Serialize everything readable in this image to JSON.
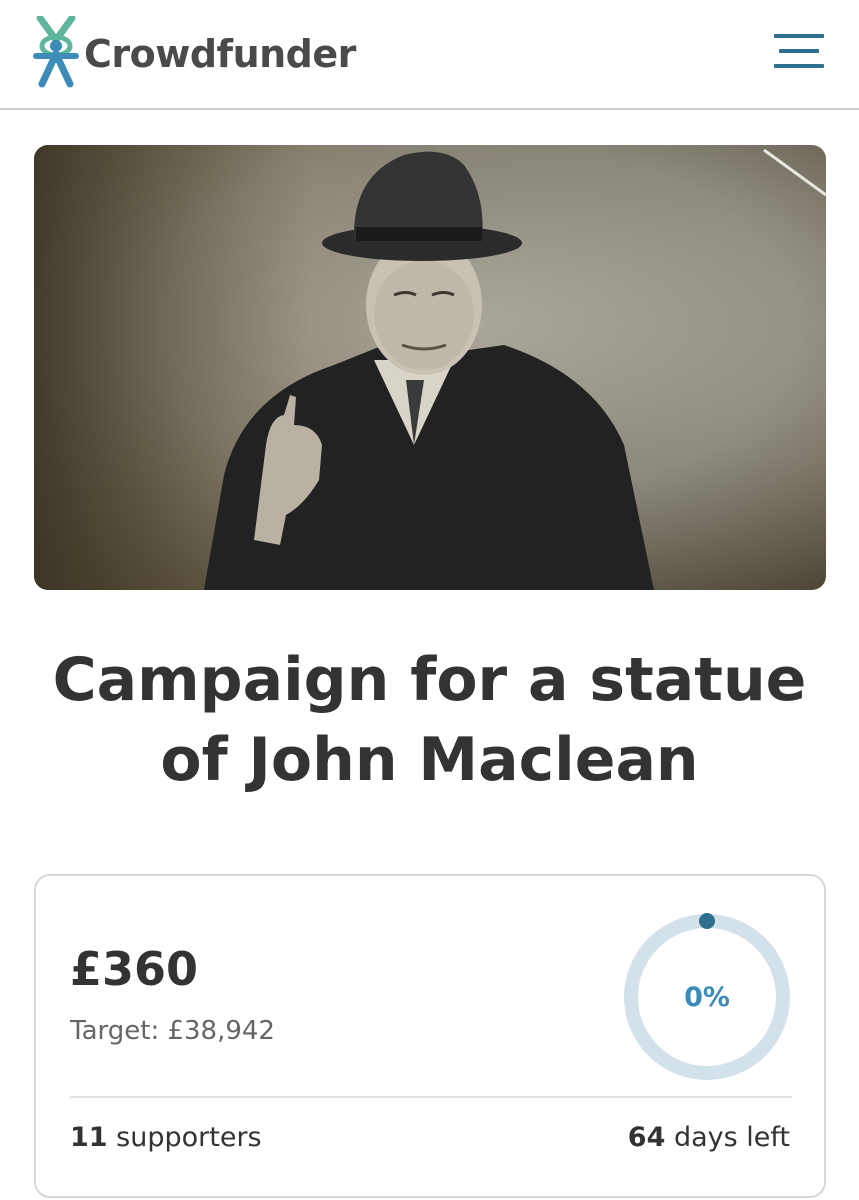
{
  "header": {
    "brand": "Crowdfunder",
    "menu_icon": "hamburger-menu-icon",
    "logo_icon": "crowdfunder-person-icon",
    "colors": {
      "logo_green": "#5fb69c",
      "logo_blue": "#3d8bb6",
      "menu": "#2f6f8f"
    }
  },
  "hero": {
    "image": "sepia-photo-man-in-hat-pointing"
  },
  "campaign": {
    "title_line1": "Campaign for a statue",
    "title_line2": "of John Maclean"
  },
  "stats": {
    "raised": "£360",
    "target": "Target: £38,942",
    "percent_label": "0%",
    "progress_fraction": 0.0,
    "supporters_count": "11",
    "supporters_label": "supporters",
    "days_count": "64",
    "days_label": "days left",
    "colors": {
      "ring_track": "#d3e2ea",
      "ring_dot": "#2f6f8f",
      "percent": "#3d8bb6"
    }
  }
}
